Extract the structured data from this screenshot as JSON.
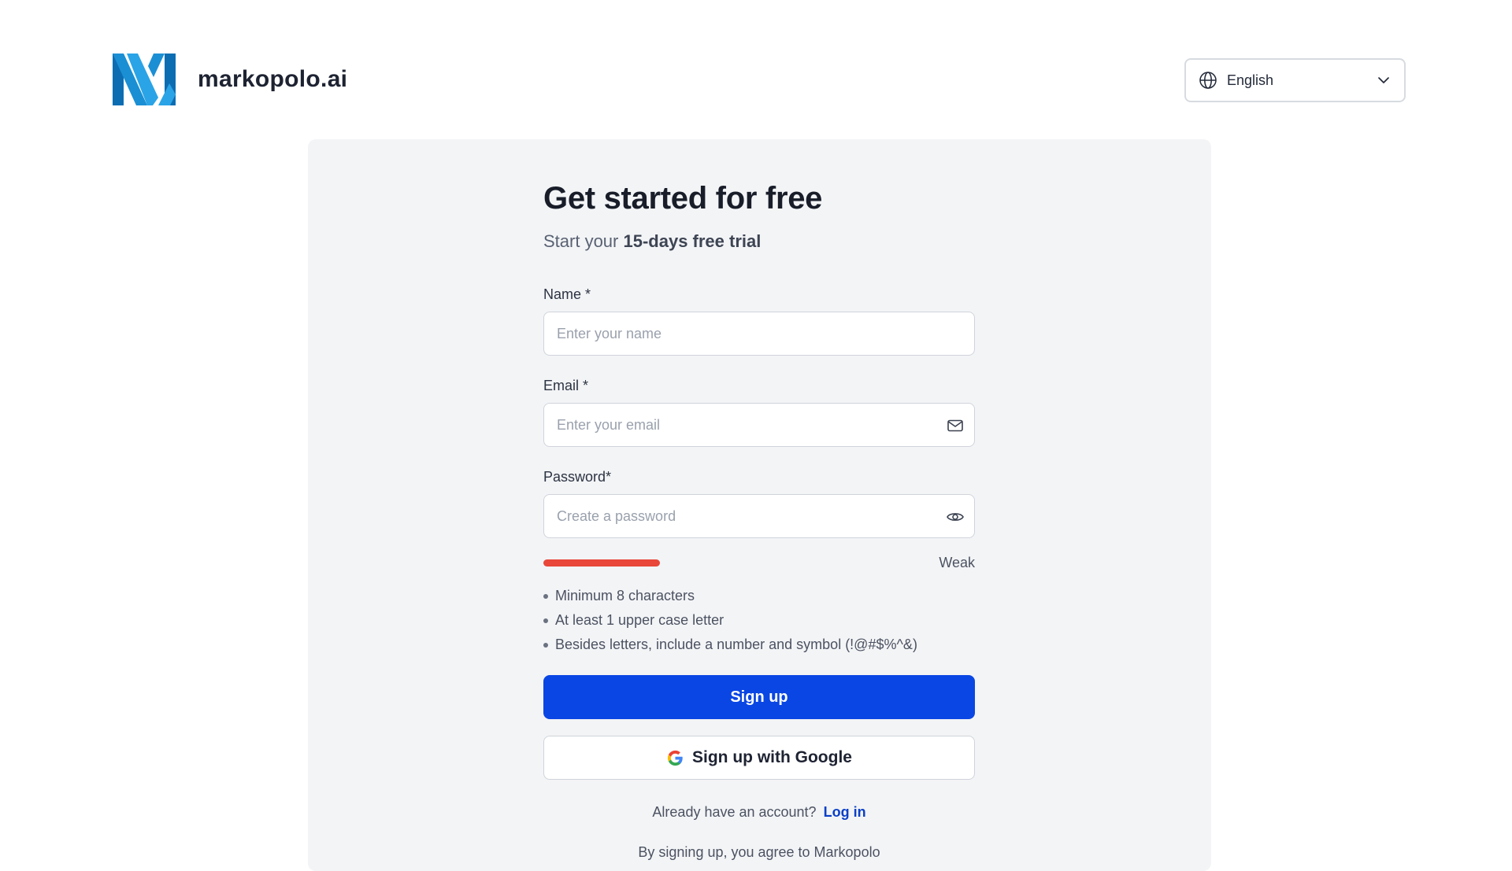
{
  "brand": {
    "name": "markopolo.ai",
    "colors": {
      "dark": "#0d6db3",
      "light": "#2aa4e6"
    }
  },
  "language": {
    "selected": "English",
    "icon": "globe-icon"
  },
  "form": {
    "title": "Get started for free",
    "subtitle_prefix": "Start your ",
    "subtitle_emphasis": "15-days free trial",
    "name": {
      "label": "Name *",
      "placeholder": "Enter your name",
      "value": ""
    },
    "email": {
      "label": "Email *",
      "placeholder": "Enter your email",
      "value": "",
      "icon": "mail-icon"
    },
    "password": {
      "label": "Password*",
      "placeholder": "Create a password",
      "value": "",
      "icon": "eye-icon"
    },
    "strength": {
      "label": "Weak",
      "level": 0.27,
      "color": "#e8473a"
    },
    "rules": [
      "Minimum 8 characters",
      "At least 1 upper case letter",
      "Besides letters, include a number and symbol (!@#$%^&)"
    ],
    "signup_label": "Sign up",
    "google_label": "Sign up with Google",
    "login_prompt": "Already have an account?",
    "login_link": "Log in",
    "terms_text": "By signing up, you agree to Markopolo"
  },
  "colors": {
    "primary": "#0a46e4",
    "card_bg": "#f3f4f6",
    "link": "#0a3fc7"
  }
}
